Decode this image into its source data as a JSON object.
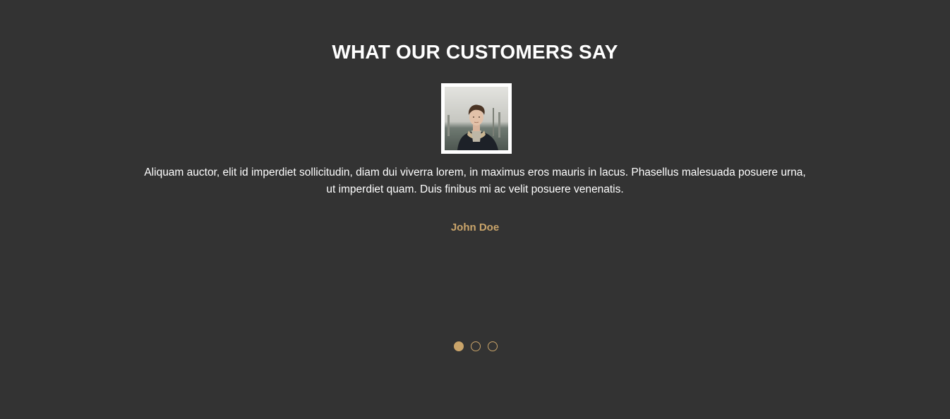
{
  "testimonials": {
    "title": "WHAT OUR CUSTOMERS SAY",
    "avatar_alt": "customer photo",
    "quote": "Aliquam auctor, elit id imperdiet sollicitudin, diam dui viverra lorem, in maximus eros mauris in lacus. Phasellus malesuada posuere urna, ut imperdiet quam. Duis finibus mi ac velit posuere venenatis.",
    "author": "John Doe",
    "active_slide": 1,
    "slide_count": 3
  },
  "colors": {
    "background": "#333333",
    "accent": "#c9a46a",
    "text": "#ffffff"
  }
}
